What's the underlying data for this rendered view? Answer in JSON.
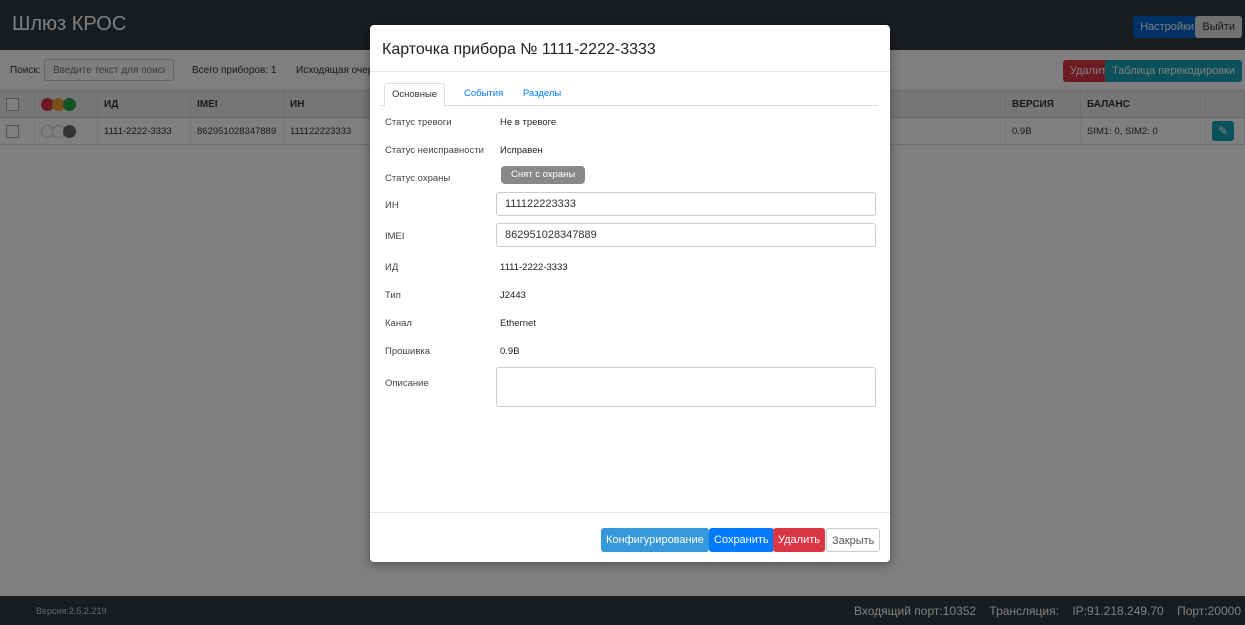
{
  "app": {
    "title": "Шлюз КРОС"
  },
  "header": {
    "settings_label": "Настройки",
    "exit_label": "Выйти"
  },
  "toolbar": {
    "search_label": "Поиск:",
    "search_placeholder": "Введите текст для поиска",
    "total_label": "Всего приборов: 1",
    "queue_label": "Исходящая очере",
    "delete_label": "Удалить",
    "recode_label": "Таблица перекодировки"
  },
  "table": {
    "headers": {
      "id": "ИД",
      "imei": "IMEI",
      "in": "ИН",
      "version": "ВЕРСИЯ",
      "balance": "БАЛАНС"
    },
    "header_dot_colors": [
      "#dc3545",
      "#f0a030",
      "#28a745"
    ],
    "row_dot_colors": [
      "#ffffff",
      "#ffffff",
      "#666666"
    ],
    "rows": [
      {
        "id": "1111-2222-3333",
        "imei": "862951028347889",
        "in": "111122223333",
        "version": "0.9B",
        "balance": "SIM1: 0, SIM2: 0"
      }
    ]
  },
  "modal": {
    "title": "Карточка прибора № 1111-2222-3333",
    "tabs": [
      "Основные",
      "События",
      "Разделы"
    ],
    "fields": {
      "alarm_label": "Статус тревоги",
      "alarm_value": "Не в тревоге",
      "fault_label": "Статус неисправности",
      "fault_value": "Исправен",
      "guard_label": "Статус охраны",
      "guard_value": "Снят с охраны",
      "in_label": "ИН",
      "in_value": "111122223333",
      "imei_label": "IMEI",
      "imei_value": "862951028347889",
      "id_label": "ИД",
      "id_value": "1111-2222-3333",
      "type_label": "Тип",
      "type_value": "J2443",
      "channel_label": "Канал",
      "channel_value": "Ethernet",
      "firmware_label": "Прошивка",
      "firmware_value": "0.9B",
      "description_label": "Описание"
    },
    "buttons": {
      "configure": "Конфигурирование",
      "save": "Сохранить",
      "delete": "Удалить",
      "close": "Закрыть"
    }
  },
  "footer": {
    "version": "Версия:2.5.2.219",
    "incoming_port": "Входящий порт:10352",
    "translation": "Трансляция:",
    "ip": "IP:91.218.249.70",
    "port": "Порт:20000"
  }
}
